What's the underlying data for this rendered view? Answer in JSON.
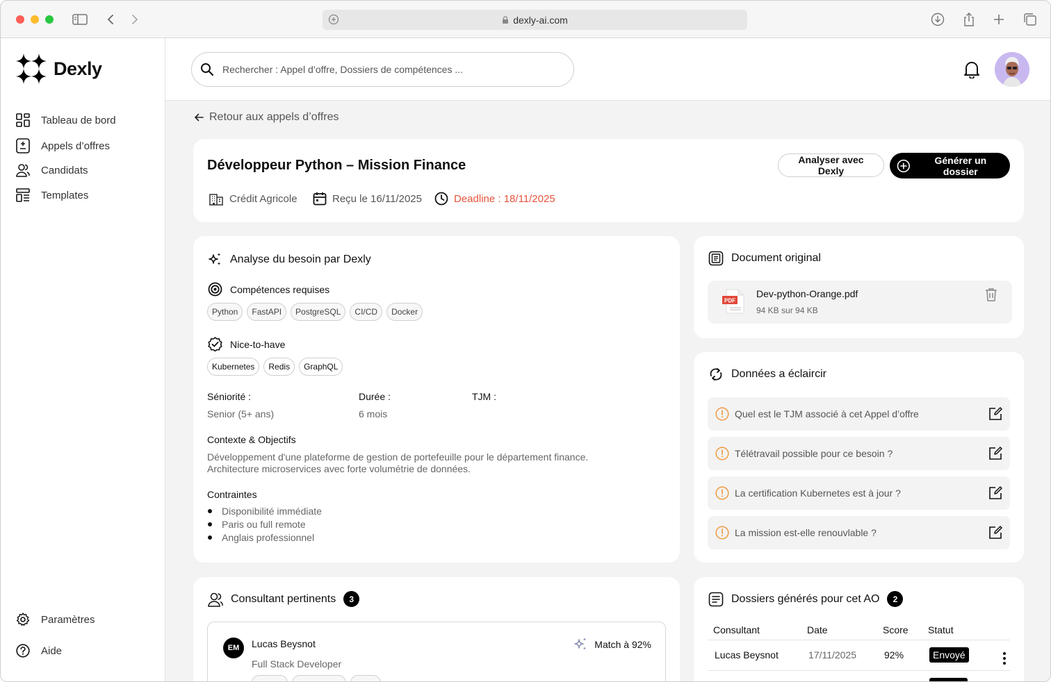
{
  "browser": {
    "url": "dexly-ai.com"
  },
  "app": {
    "name": "Dexly"
  },
  "sidebar": {
    "items": [
      {
        "label": "Tableau de bord",
        "icon": "dashboard-icon"
      },
      {
        "label": "Appels d’offres",
        "icon": "tenders-icon"
      },
      {
        "label": "Candidats",
        "icon": "users-icon"
      },
      {
        "label": "Templates",
        "icon": "template-icon"
      }
    ],
    "bottom": [
      {
        "label": "Paramètres",
        "icon": "gear-icon"
      },
      {
        "label": "Aide",
        "icon": "help-icon"
      }
    ]
  },
  "search": {
    "placeholder": "Rechercher : Appel d’offre, Dossiers de compétences ..."
  },
  "back_link": "Retour aux appels d’offres",
  "header": {
    "title": "Développeur Python – Mission Finance",
    "company": "Crédit Agricole",
    "received": "Reçu le 16/11/2025",
    "deadline": "Deadline : 18/11/2025",
    "analyze_label": "Analyser avec Dexly",
    "generate_label": "Générer un dossier"
  },
  "analysis": {
    "title": "Analyse du besoin par Dexly",
    "required_title": "Compétences requises",
    "required": [
      "Python",
      "FastAPI",
      "PostgreSQL",
      "CI/CD",
      "Docker"
    ],
    "nice_title": "Nice-to-have",
    "nice": [
      "Kubernetes",
      "Redis",
      "GraphQL"
    ],
    "seniority_label": "Séniorité :",
    "seniority_value": "Senior (5+ ans)",
    "duration_label": "Durée :",
    "duration_value": "6 mois",
    "tjm_label": "TJM :",
    "context_title": "Contexte & Objectifs",
    "context_line1": "Développement d'une plateforme de gestion de portefeuille pour le département finance.",
    "context_line2": "Architecture microservices avec forte volumétrie de données.",
    "constraints_title": "Contraintes",
    "constraints": [
      "Disponibilité immédiate",
      "Paris ou full remote",
      "Anglais professionnel"
    ]
  },
  "document": {
    "title": "Document original",
    "file_name": "Dev-python-Orange.pdf",
    "file_size": "94 KB sur 94 KB",
    "file_badge": "PDF"
  },
  "questions": {
    "title": "Données a éclaircir",
    "items": [
      "Quel est le TJM associé à cet Appel d’offre",
      "Télétravail possible pour ce besoin ?",
      "La certification Kubernetes est à jour ?",
      "La mission est-elle renouvlable ?"
    ]
  },
  "consultants": {
    "title": "Consultant pertinents",
    "count": "3",
    "first": {
      "initials": "EM",
      "name": "Lucas Beysnot",
      "role": "Full Stack Developer",
      "match": "Match à 92%"
    }
  },
  "dossiers": {
    "title": "Dossiers générés pour cet AO",
    "count": "2",
    "columns": [
      "Consultant",
      "Date",
      "Score",
      "Statut"
    ],
    "rows": [
      {
        "consultant": "Lucas Beysnot",
        "date": "17/11/2025",
        "score": "92%",
        "status": "Envoyé"
      }
    ]
  },
  "colors": {
    "accent": "#000000",
    "deadline": "#e5533d",
    "warning": "#f0a04b"
  }
}
